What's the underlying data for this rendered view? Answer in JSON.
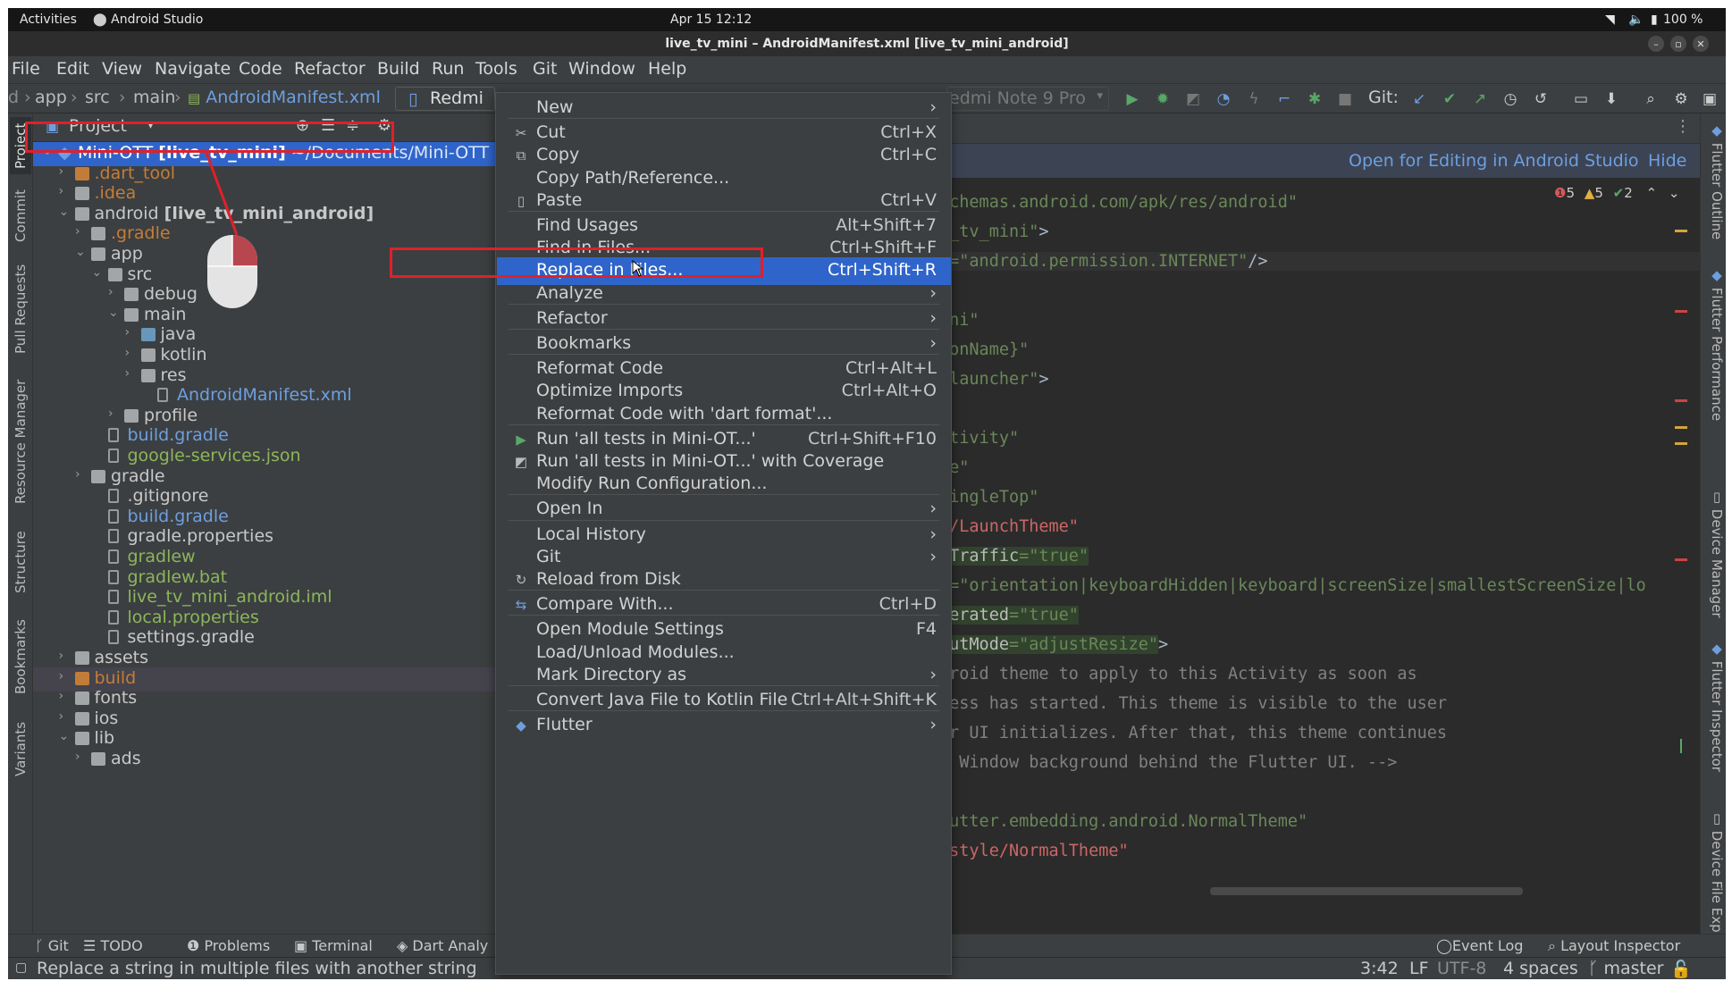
{
  "colors": {
    "accent_selection": "#2f65ca",
    "annotation_red": "#e0202a",
    "ide_background": "#3c3f41",
    "editor_background": "#2b2b2b",
    "link_blue": "#6d9fe0"
  },
  "system_bar": {
    "activities": "Activities",
    "app_name": "Android Studio",
    "datetime": "Apr 15  12:12",
    "battery": "100 %"
  },
  "window": {
    "title": "live_tv_mini – AndroidManifest.xml [live_tv_mini_android]"
  },
  "menu": [
    "File",
    "Edit",
    "View",
    "Navigate",
    "Code",
    "Refactor",
    "Build",
    "Run",
    "Tools",
    "Git",
    "Window",
    "Help"
  ],
  "breadcrumb": [
    "app",
    "src",
    "main",
    "AndroidManifest.xml"
  ],
  "toolbar": {
    "device_partial_left": "Redmi",
    "device_partial_right": "edmi Note 9 Pro",
    "git_label": "Git:"
  },
  "project_panel": {
    "title": "Project",
    "tree": [
      {
        "label": "Mini-OTT",
        "bold": "[live_tv_mini]",
        "path": "~/Documents/Mini-OTT",
        "indent": 0,
        "arrow": "v",
        "icon": "flutter"
      },
      {
        "label": ".dart_tool",
        "indent": 1,
        "arrow": ">",
        "icon": "folder-orange",
        "color": "orange"
      },
      {
        "label": ".idea",
        "indent": 1,
        "arrow": ">",
        "icon": "folder",
        "color": "orange"
      },
      {
        "label": "android",
        "bold": "[live_tv_mini_android]",
        "indent": 1,
        "arrow": "v",
        "icon": "folder"
      },
      {
        "label": ".gradle",
        "indent": 2,
        "arrow": ">",
        "icon": "folder",
        "color": "orange"
      },
      {
        "label": "app",
        "indent": 2,
        "arrow": "v",
        "icon": "folder"
      },
      {
        "label": "src",
        "indent": 3,
        "arrow": "v",
        "icon": "folder"
      },
      {
        "label": "debug",
        "indent": 4,
        "arrow": ">",
        "icon": "folder"
      },
      {
        "label": "main",
        "indent": 4,
        "arrow": "v",
        "icon": "folder"
      },
      {
        "label": "java",
        "indent": 5,
        "arrow": ">",
        "icon": "folder-blue"
      },
      {
        "label": "kotlin",
        "indent": 5,
        "arrow": ">",
        "icon": "folder"
      },
      {
        "label": "res",
        "indent": 5,
        "arrow": ">",
        "icon": "folder"
      },
      {
        "label": "AndroidManifest.xml",
        "indent": 6,
        "arrow": "",
        "icon": "file",
        "color": "blue"
      },
      {
        "label": "profile",
        "indent": 4,
        "arrow": ">",
        "icon": "folder"
      },
      {
        "label": "build.gradle",
        "indent": 3,
        "arrow": "",
        "icon": "file",
        "color": "blue"
      },
      {
        "label": "google-services.json",
        "indent": 3,
        "arrow": "",
        "icon": "file",
        "color": "green"
      },
      {
        "label": "gradle",
        "indent": 2,
        "arrow": ">",
        "icon": "folder"
      },
      {
        "label": ".gitignore",
        "indent": 3,
        "arrow": "",
        "icon": "file"
      },
      {
        "label": "build.gradle",
        "indent": 3,
        "arrow": "",
        "icon": "file",
        "color": "blue"
      },
      {
        "label": "gradle.properties",
        "indent": 3,
        "arrow": "",
        "icon": "file"
      },
      {
        "label": "gradlew",
        "indent": 3,
        "arrow": "",
        "icon": "file",
        "color": "green"
      },
      {
        "label": "gradlew.bat",
        "indent": 3,
        "arrow": "",
        "icon": "file",
        "color": "green"
      },
      {
        "label": "live_tv_mini_android.iml",
        "indent": 3,
        "arrow": "",
        "icon": "file",
        "color": "green"
      },
      {
        "label": "local.properties",
        "indent": 3,
        "arrow": "",
        "icon": "file",
        "color": "green"
      },
      {
        "label": "settings.gradle",
        "indent": 3,
        "arrow": "",
        "icon": "file"
      },
      {
        "label": "assets",
        "indent": 1,
        "arrow": ">",
        "icon": "folder"
      },
      {
        "label": "build",
        "indent": 1,
        "arrow": ">",
        "icon": "folder-orange",
        "color": "orange",
        "highlight": true
      },
      {
        "label": "fonts",
        "indent": 1,
        "arrow": ">",
        "icon": "folder"
      },
      {
        "label": "ios",
        "indent": 1,
        "arrow": ">",
        "icon": "folder"
      },
      {
        "label": "lib",
        "indent": 1,
        "arrow": "v",
        "icon": "folder"
      },
      {
        "label": "ads",
        "indent": 2,
        "arrow": ">",
        "icon": "folder"
      }
    ]
  },
  "editor": {
    "notice": "Open for Editing in Android Studio",
    "notice_hide": "Hide",
    "inspections": {
      "errors": "5",
      "warnings": "5",
      "weak": "2"
    }
  },
  "left_tabs": [
    "Project",
    "Commit",
    "Pull Requests",
    "Resource Manager",
    "Structure",
    "Bookmarks",
    "Variants"
  ],
  "right_tabs": [
    "Flutter Outline",
    "Flutter Performance",
    "Device Manager",
    "Flutter Inspector",
    "Device File Exp"
  ],
  "context_menu": {
    "items": [
      {
        "label": "New",
        "shortcut": "",
        "submenu": true,
        "icon": ""
      },
      {
        "sep": true
      },
      {
        "label": "Cut",
        "shortcut": "Ctrl+X",
        "icon": "scissors-icon"
      },
      {
        "label": "Copy",
        "shortcut": "Ctrl+C",
        "icon": "copy-icon"
      },
      {
        "label": "Copy Path/Reference...",
        "shortcut": ""
      },
      {
        "label": "Paste",
        "shortcut": "Ctrl+V",
        "icon": "paste-icon"
      },
      {
        "sep": true
      },
      {
        "label": "Find Usages",
        "shortcut": "Alt+Shift+7"
      },
      {
        "label": "Find in Files...",
        "shortcut": "Ctrl+Shift+F"
      },
      {
        "label": "Replace in Files...",
        "shortcut": "Ctrl+Shift+R",
        "active": true
      },
      {
        "label": "Analyze",
        "shortcut": "",
        "submenu": true
      },
      {
        "sep": true
      },
      {
        "label": "Refactor",
        "shortcut": "",
        "submenu": true
      },
      {
        "sep": true
      },
      {
        "label": "Bookmarks",
        "shortcut": "",
        "submenu": true
      },
      {
        "sep": true
      },
      {
        "label": "Reformat Code",
        "shortcut": "Ctrl+Alt+L"
      },
      {
        "label": "Optimize Imports",
        "shortcut": "Ctrl+Alt+O"
      },
      {
        "label": "Reformat Code with 'dart format'...",
        "shortcut": ""
      },
      {
        "sep": true
      },
      {
        "label": "Run 'all tests in Mini-OT...'",
        "shortcut": "Ctrl+Shift+F10",
        "icon": "run-icon"
      },
      {
        "label": "Run 'all tests in Mini-OT...' with Coverage",
        "shortcut": "",
        "icon": "coverage-icon"
      },
      {
        "label": "Modify Run Configuration...",
        "shortcut": ""
      },
      {
        "sep": true
      },
      {
        "label": "Open In",
        "shortcut": "",
        "submenu": true
      },
      {
        "sep": true
      },
      {
        "label": "Local History",
        "shortcut": "",
        "submenu": true
      },
      {
        "label": "Git",
        "shortcut": "",
        "submenu": true
      },
      {
        "label": "Reload from Disk",
        "shortcut": "",
        "icon": "reload-icon"
      },
      {
        "sep": true
      },
      {
        "label": "Compare With...",
        "shortcut": "Ctrl+D",
        "icon": "compare-icon"
      },
      {
        "sep": true
      },
      {
        "label": "Open Module Settings",
        "shortcut": "F4"
      },
      {
        "label": "Load/Unload Modules...",
        "shortcut": ""
      },
      {
        "label": "Mark Directory as",
        "shortcut": "",
        "submenu": true
      },
      {
        "sep": true
      },
      {
        "label": "Convert Java File to Kotlin File",
        "shortcut": "Ctrl+Alt+Shift+K"
      },
      {
        "sep": true
      },
      {
        "label": "Flutter",
        "shortcut": "",
        "submenu": true,
        "icon": "flutter-icon"
      }
    ]
  },
  "bottom_tools": [
    "Git",
    "TODO",
    "Problems",
    "Terminal",
    "Dart Analy",
    "Event Log",
    "Layout Inspector"
  ],
  "status": {
    "message": "Replace a string in multiple files with another string",
    "position": "3:42",
    "line_ending": "LF",
    "encoding": "UTF-8",
    "indent": "4 spaces",
    "branch": "master"
  }
}
